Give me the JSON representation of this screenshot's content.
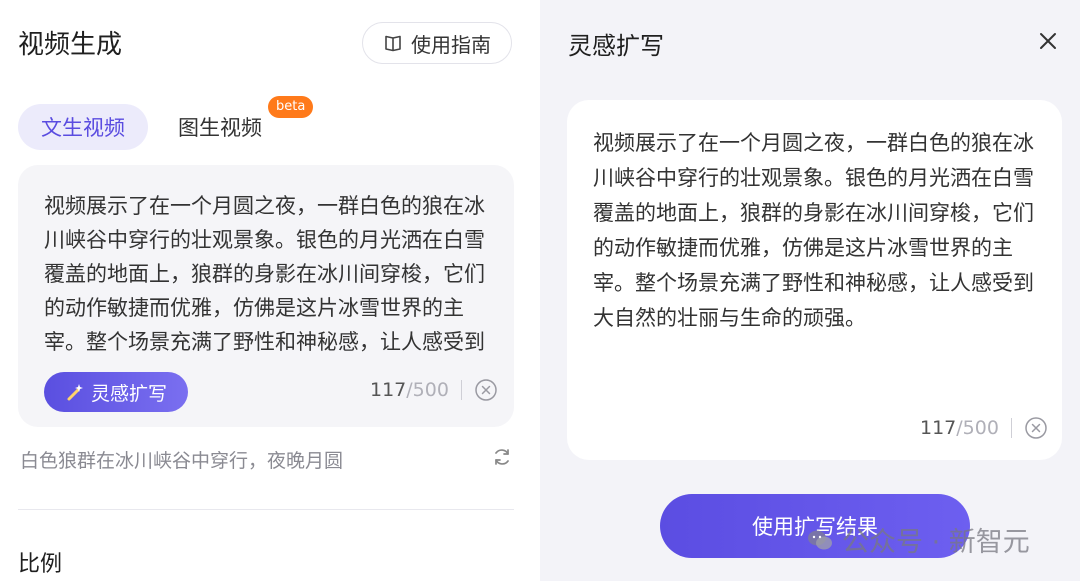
{
  "left": {
    "title": "视频生成",
    "guide_label": "使用指南",
    "tabs": [
      {
        "label": "文生视频",
        "active": true
      },
      {
        "label": "图生视频",
        "active": false
      }
    ],
    "beta_badge": "beta",
    "prompt_text": "视频展示了在一个月圆之夜，一群白色的狼在冰川峡谷中穿行的壮观景象。银色的月光洒在白雪覆盖的地面上，狼群的身影在冰川间穿梭，它们的动作敏捷而优雅，仿佛是这片冰雪世界的主宰。整个场景充满了野性和神秘感，让人感受到大自然的壮丽与生命的顽强。",
    "inspire_label": "灵感扩写",
    "count": "117",
    "max": "/500",
    "hint": "白色狼群在冰川峡谷中穿行，夜晚月圆",
    "ratio_label": "比例"
  },
  "right": {
    "title": "灵感扩写",
    "result_text": "视频展示了在一个月圆之夜，一群白色的狼在冰川峡谷中穿行的壮观景象。银色的月光洒在白雪覆盖的地面上，狼群的身影在冰川间穿梭，它们的动作敏捷而优雅，仿佛是这片冰雪世界的主宰。整个场景充满了野性和神秘感，让人感受到大自然的壮丽与生命的顽强。",
    "count": "117",
    "max": "/500",
    "use_label": "使用扩写结果"
  },
  "watermark": "公众号 · 新智元",
  "colors": {
    "accent": "#5a4ce0",
    "beta": "#ff7a1a",
    "tab_active_bg": "#ecebfb"
  },
  "icons": [
    "book-icon",
    "magic-wand-icon",
    "clear-icon",
    "refresh-icon",
    "close-icon",
    "wechat-logo-icon"
  ]
}
